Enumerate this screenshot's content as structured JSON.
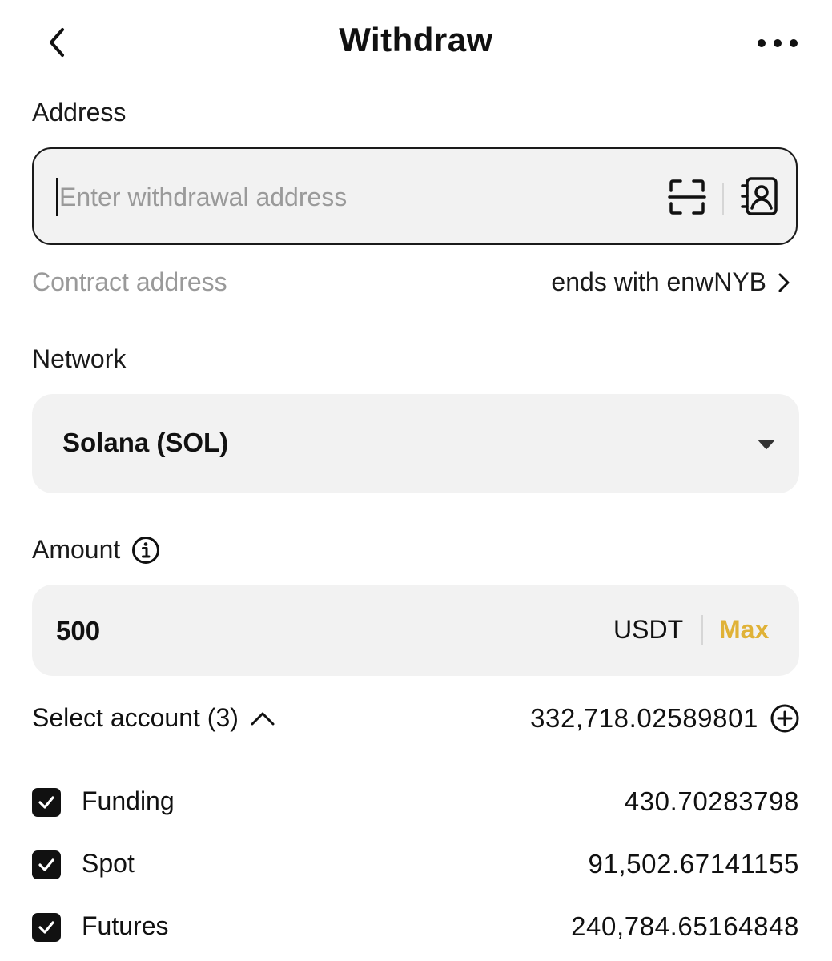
{
  "header": {
    "title": "Withdraw",
    "back_icon": "chevron-left-icon",
    "more_icon": "more-horizontal-icon"
  },
  "address": {
    "label": "Address",
    "placeholder": "Enter withdrawal address",
    "value": "",
    "scan_icon": "scan-icon",
    "contacts_icon": "address-book-icon"
  },
  "contract": {
    "label": "Contract address",
    "value": "ends with enwNYB"
  },
  "network": {
    "label": "Network",
    "selected": "Solana (SOL)"
  },
  "amount": {
    "label": "Amount",
    "value": "500",
    "currency": "USDT",
    "max_label": "Max",
    "max_color": "#e0b237"
  },
  "accounts": {
    "select_label": "Select account (3)",
    "total": "332,718.02589801",
    "items": [
      {
        "name": "Funding",
        "balance": "430.70283798",
        "checked": true
      },
      {
        "name": "Spot",
        "balance": "91,502.67141155",
        "checked": true
      },
      {
        "name": "Futures",
        "balance": "240,784.65164848",
        "checked": true
      }
    ]
  }
}
